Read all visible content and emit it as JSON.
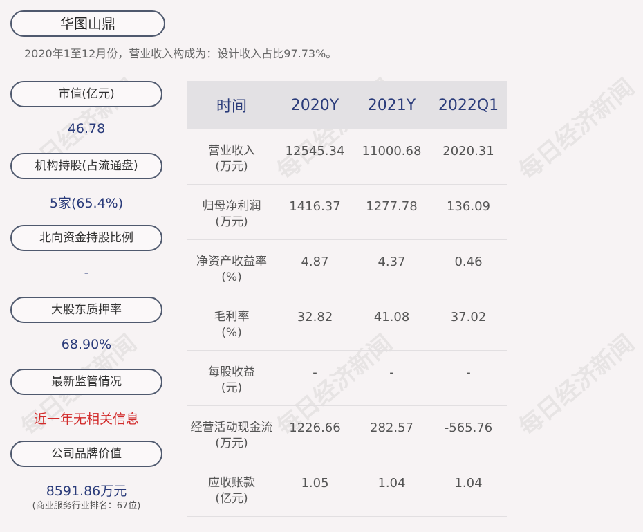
{
  "title": "华图山鼎",
  "subtitle": "2020年1至12月份，营业收入构成为：设计收入占比97.73%。",
  "side": [
    {
      "label": "市值(亿元)",
      "value": "46.78"
    },
    {
      "label": "机构持股(占流通盘)",
      "value": "5家(65.4%)"
    },
    {
      "label": "北向资金持股比例",
      "value": "-"
    },
    {
      "label": "大股东质押率",
      "value": "68.90%"
    },
    {
      "label": "最新监管情况",
      "value": "近一年无相关信息"
    },
    {
      "label": "公司品牌价值",
      "value": "8591.86万元",
      "note": "(商业服务行业排名：67位)"
    }
  ],
  "table": {
    "headers": [
      "时间",
      "2020Y",
      "2021Y",
      "2022Q1"
    ],
    "rows": [
      {
        "label1": "营业收入",
        "label2": "(万元)",
        "values": [
          "12545.34",
          "11000.68",
          "2020.31"
        ]
      },
      {
        "label1": "归母净利润",
        "label2": "(万元)",
        "values": [
          "1416.37",
          "1277.78",
          "136.09"
        ]
      },
      {
        "label1": "净资产收益率",
        "label2": "(%)",
        "values": [
          "4.87",
          "4.37",
          "0.46"
        ]
      },
      {
        "label1": "毛利率",
        "label2": "(%)",
        "values": [
          "32.82",
          "41.08",
          "37.02"
        ]
      },
      {
        "label1": "每股收益",
        "label2": "(元)",
        "values": [
          "-",
          "-",
          "-"
        ]
      },
      {
        "label1": "经营活动现金流",
        "label2": "(万元)",
        "values": [
          "1226.66",
          "282.57",
          "-565.76"
        ]
      },
      {
        "label1": "应收账款",
        "label2": "(亿元)",
        "values": [
          "1.05",
          "1.04",
          "1.04"
        ]
      }
    ]
  },
  "watermark": "每日经济新闻",
  "colors": {
    "accent": "#2a3b7a",
    "alert": "#d22b2b",
    "header_bg": "#e3e1e4",
    "background": "#f7f3f4"
  }
}
